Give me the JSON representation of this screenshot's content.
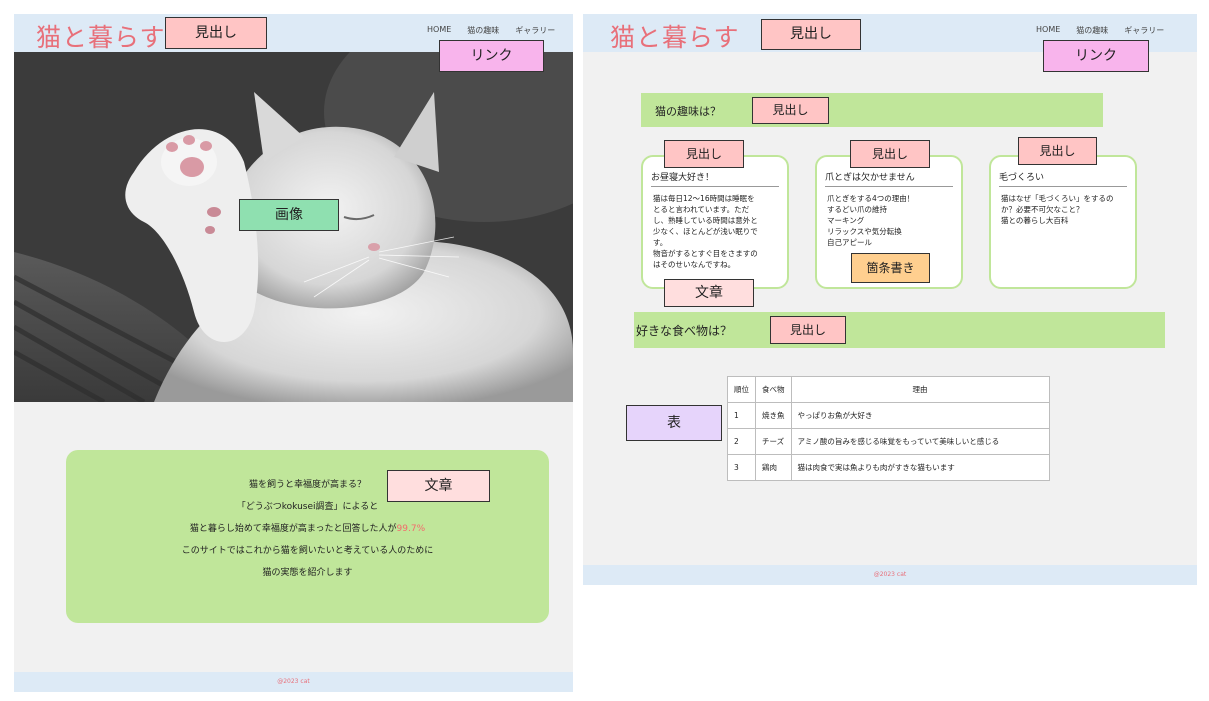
{
  "site": {
    "logo": "猫と暮らす",
    "nav": [
      "HOME",
      "猫の趣味",
      "ギャラリー"
    ],
    "footer": "@2023 cat"
  },
  "home": {
    "intro": {
      "line1": "猫を飼うと幸福度が高まる？",
      "line2": "「どうぶつkokusei調査」によると",
      "line3_prefix": "猫と暮らし始めて幸福度が高まったと回答した人が",
      "line3_percent": "99.7%",
      "line4": "このサイトではこれから猫を飼いたいと考えている人のために",
      "line5": "猫の実態を紹介します"
    }
  },
  "hobby": {
    "section_title": "猫の趣味は？",
    "cards": [
      {
        "title": "お昼寝大好き！",
        "lines": [
          "猫は毎日12〜16時間は睡眠を",
          "とると言われています。ただ",
          "し、熟睡している時間は意外と",
          "少なく、ほとんどが浅い眠りで",
          "す。",
          "物音がするとすぐ目をさますの",
          "はそのせいなんですね。"
        ]
      },
      {
        "title": "爪とぎは欠かせません",
        "lines": [
          "爪とぎをする4つの理由！",
          "するどい爪の維持",
          "マーキング",
          "リラックスや気分転換",
          "自己アピール"
        ]
      },
      {
        "title": "毛づくろい",
        "lines": [
          "猫はなぜ「毛づくろい」をするの",
          "か？必要不可欠なこと？",
          "猫との暮らし大百科"
        ]
      }
    ],
    "food_title": "好きな食べ物は？",
    "table": {
      "headers": [
        "順位",
        "食べ物",
        "理由"
      ],
      "rows": [
        [
          "1",
          "焼き魚",
          "やっぱりお魚が大好き"
        ],
        [
          "2",
          "チーズ",
          "アミノ酸の旨みを感じる味覚をもっていて美味しいと感じる"
        ],
        [
          "3",
          "鶏肉",
          "猫は肉食で実は魚よりも肉がすきな猫もいます"
        ]
      ]
    }
  },
  "annotations": {
    "heading": "見出し",
    "link": "リンク",
    "image": "画像",
    "text": "文章",
    "bullets": "箇条書き",
    "table": "表"
  },
  "colors": {
    "header_bg": "#ddeaf6",
    "logo": "#e8707a",
    "green_box": "#c0e69a",
    "percent": "#f36b6b"
  }
}
